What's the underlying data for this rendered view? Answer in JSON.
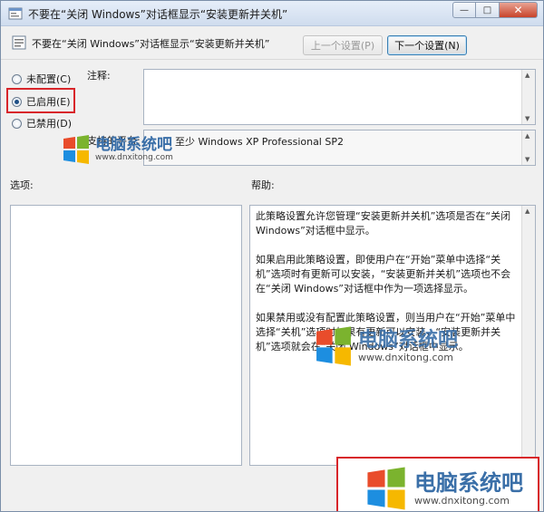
{
  "window": {
    "title": "不要在“关闭 Windows”对话框显示“安装更新并关机”",
    "minimize_glyph": "—",
    "maximize_glyph": "□",
    "close_glyph": "✕"
  },
  "header": {
    "setting_title": "不要在“关闭 Windows”对话框显示“安装更新并关机”",
    "prev_button": "上一个设置(P)",
    "next_button": "下一个设置(N)"
  },
  "state": {
    "options": [
      {
        "label": "未配置(C)",
        "checked": false
      },
      {
        "label": "已启用(E)",
        "checked": true
      },
      {
        "label": "已禁用(D)",
        "checked": false
      }
    ]
  },
  "comment": {
    "label": "注释:",
    "value": ""
  },
  "platform": {
    "label": "支持的平台:",
    "value": "至少 Windows XP Professional SP2"
  },
  "options_panel": {
    "label": "选项:"
  },
  "help_panel": {
    "label": "帮助:",
    "paragraphs": [
      "此策略设置允许您管理“安装更新并关机”选项是否在“关闭 Windows”对话框中显示。",
      "如果启用此策略设置，即使用户在“开始”菜单中选择“关机”选项时有更新可以安装，“安装更新并关机”选项也不会在“关闭 Windows”对话框中作为一项选择显示。",
      "如果禁用或没有配置此策略设置，则当用户在“开始”菜单中选择“关机”选项时如果有更新可以安装，“安装更新并关机”选项就会在“关闭 Windows”对话框中显示。"
    ]
  },
  "watermark": {
    "name": "电脑系统吧",
    "url": "www.dnxitong.com"
  },
  "colors": {
    "accent_red": "#d8252a",
    "title_blue": "#3a6fa8"
  }
}
